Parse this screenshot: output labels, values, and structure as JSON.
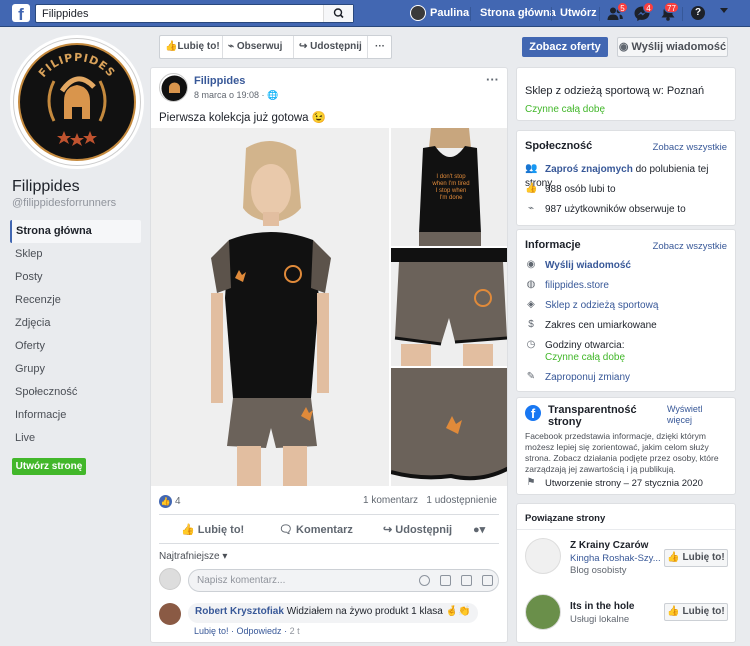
{
  "topbar": {
    "search_value": "Filippides",
    "user_name": "Paulina",
    "home_label": "Strona główna",
    "create_label": "Utwórz",
    "friend_badge": "5",
    "message_badge": "4",
    "notification_badge": "77",
    "help_label": "?"
  },
  "sidebar": {
    "page_name": "Filippides",
    "handle": "@filippidesforrunners",
    "logo_text": "FILIPPIDES",
    "items": [
      {
        "label": "Strona główna"
      },
      {
        "label": "Sklep"
      },
      {
        "label": "Posty"
      },
      {
        "label": "Recenzje"
      },
      {
        "label": "Zdjęcia"
      },
      {
        "label": "Oferty"
      },
      {
        "label": "Grupy"
      },
      {
        "label": "Społeczność"
      },
      {
        "label": "Informacje"
      },
      {
        "label": "Live"
      }
    ],
    "create_page_label": "Utwórz stronę"
  },
  "actions": {
    "like": "Lubię to!",
    "follow": "Obserwuj",
    "share": "Udostępnij",
    "more": "···",
    "cta": "Zobacz oferty",
    "message": "Wyślij wiadomość"
  },
  "post": {
    "author": "Filippides",
    "date": "8 marca o 19:08 · ",
    "text": "Pierwsza kolekcja już gotowa 😉",
    "shirt_text": "I don't stop when I'm tired I stop when I'm done",
    "reaction_count": "4",
    "comments_count": "1 komentarz",
    "shares_count": "1 udostępnienie",
    "like_action": "Lubię to!",
    "comment_action": "Komentarz",
    "share_action": "Udostępnij",
    "sort_label": "Najtrafniejsze ▾",
    "comment_placeholder": "Napisz komentarz...",
    "comment": {
      "author": "Robert Krysztofiak",
      "text": "Widziałem na żywo produkt 1 klasa 🤞👏",
      "like": "Lubię to!",
      "reply": "Odpowiedz",
      "time": "2 t"
    }
  },
  "right": {
    "shop": {
      "title": "Sklep z odzieżą sportową w: Poznań",
      "hours": "Czynne całą dobę"
    },
    "community": {
      "title": "Społeczność",
      "see_all": "Zobacz wszystkie",
      "invite_link": "Zaproś znajomych",
      "invite_rest": " do polubienia tej strony",
      "likes": "988 osób lubi to",
      "follows": "987 użytkowników obserwuje to"
    },
    "info": {
      "title": "Informacje",
      "see_all": "Zobacz wszystkie",
      "message": "Wyślij wiadomość",
      "website": "filippides.store",
      "category": "Sklep z odzieżą sportową",
      "price": "Zakres cen umiarkowane",
      "hours_label": "Godziny otwarcia:",
      "hours_value": "Czynne całą dobę",
      "suggest": "Zaproponuj zmiany"
    },
    "transparency": {
      "title": "Transparentność strony",
      "show_more": "Wyświetl więcej",
      "desc": "Facebook przedstawia informacje, dzięki którym możesz lepiej się zorientować, jakim celom służy strona. Zobacz działania podjęte przez osoby, które zarządzają jej zawartością i ją publikują.",
      "created": "Utworzenie strony – 27 stycznia 2020"
    },
    "related": {
      "title": "Powiązane strony",
      "pages": [
        {
          "name": "Z Krainy Czarów",
          "sub1": "Kingha Roshak-Szy...",
          "sub2": "Blog osobisty",
          "like": "Lubię to!"
        },
        {
          "name": "Its in the hole",
          "sub1": "Usługi lokalne",
          "like": "Lubię to!"
        }
      ]
    }
  }
}
